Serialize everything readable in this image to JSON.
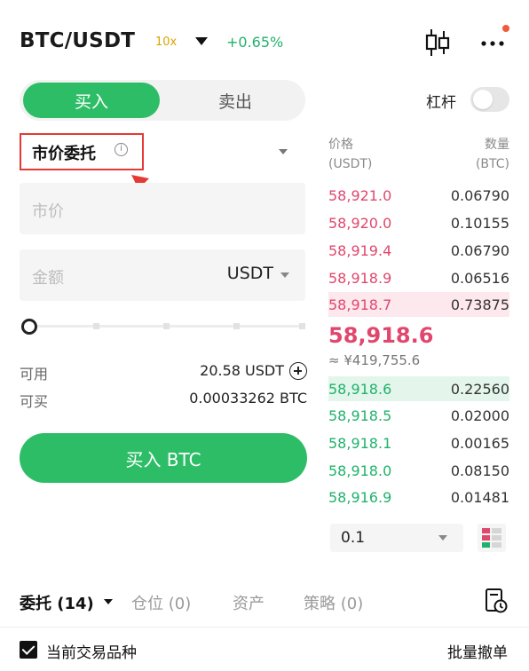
{
  "header": {
    "pair": "BTC/USDT",
    "leverage": "10x",
    "change": "+0.65%",
    "icons": [
      "candlestick-icon",
      "more-icon"
    ]
  },
  "trade_tabs": {
    "buy": "买入",
    "sell": "卖出"
  },
  "leverage_toggle": {
    "label": "杠杆",
    "on": false
  },
  "order_type": {
    "label": "市价委托",
    "info_glyph": "i"
  },
  "market_field": {
    "placeholder": "市价"
  },
  "amount_field": {
    "placeholder": "金额",
    "unit": "USDT"
  },
  "slider": {
    "value_percent": 0,
    "ticks": [
      25,
      50,
      75,
      100
    ]
  },
  "balances": {
    "available_label": "可用",
    "available_value": "20.58 USDT",
    "buyable_label": "可买",
    "buyable_value": "0.00033262 BTC"
  },
  "buy_button": {
    "label": "买入 BTC"
  },
  "orderbook": {
    "price_header": "价格",
    "price_unit": "(USDT)",
    "qty_header": "数量",
    "qty_unit": "(BTC)",
    "asks": [
      {
        "price": "58,921.0",
        "qty": "0.06790",
        "depth": 0
      },
      {
        "price": "58,920.0",
        "qty": "0.10155",
        "depth": 0
      },
      {
        "price": "58,919.4",
        "qty": "0.06790",
        "depth": 0
      },
      {
        "price": "58,918.9",
        "qty": "0.06516",
        "depth": 0
      },
      {
        "price": "58,918.7",
        "qty": "0.73875",
        "depth": 1.0
      }
    ],
    "last_price": "58,918.6",
    "fiat_price": "≈ ¥419,755.6",
    "bids": [
      {
        "price": "58,918.6",
        "qty": "0.22560",
        "depth": 1.0
      },
      {
        "price": "58,918.5",
        "qty": "0.02000",
        "depth": 0
      },
      {
        "price": "58,918.1",
        "qty": "0.00165",
        "depth": 0
      },
      {
        "price": "58,918.0",
        "qty": "0.08150",
        "depth": 0
      },
      {
        "price": "58,916.9",
        "qty": "0.01481",
        "depth": 0
      }
    ],
    "depth_step": "0.1"
  },
  "bottom_tabs": {
    "orders": "委托 (14)",
    "positions": "仓位 (0)",
    "assets": "资产",
    "strategies": "策略 (0)"
  },
  "filter": {
    "label": "当前交易品种",
    "checked": true,
    "cancel_all": "批量撤单"
  },
  "colors": {
    "buy_green": "#2ebd67",
    "ask_red": "#e0476d",
    "bid_green": "#20b26c",
    "highlight_red": "#e53935",
    "leverage_gold": "#d9a400"
  }
}
